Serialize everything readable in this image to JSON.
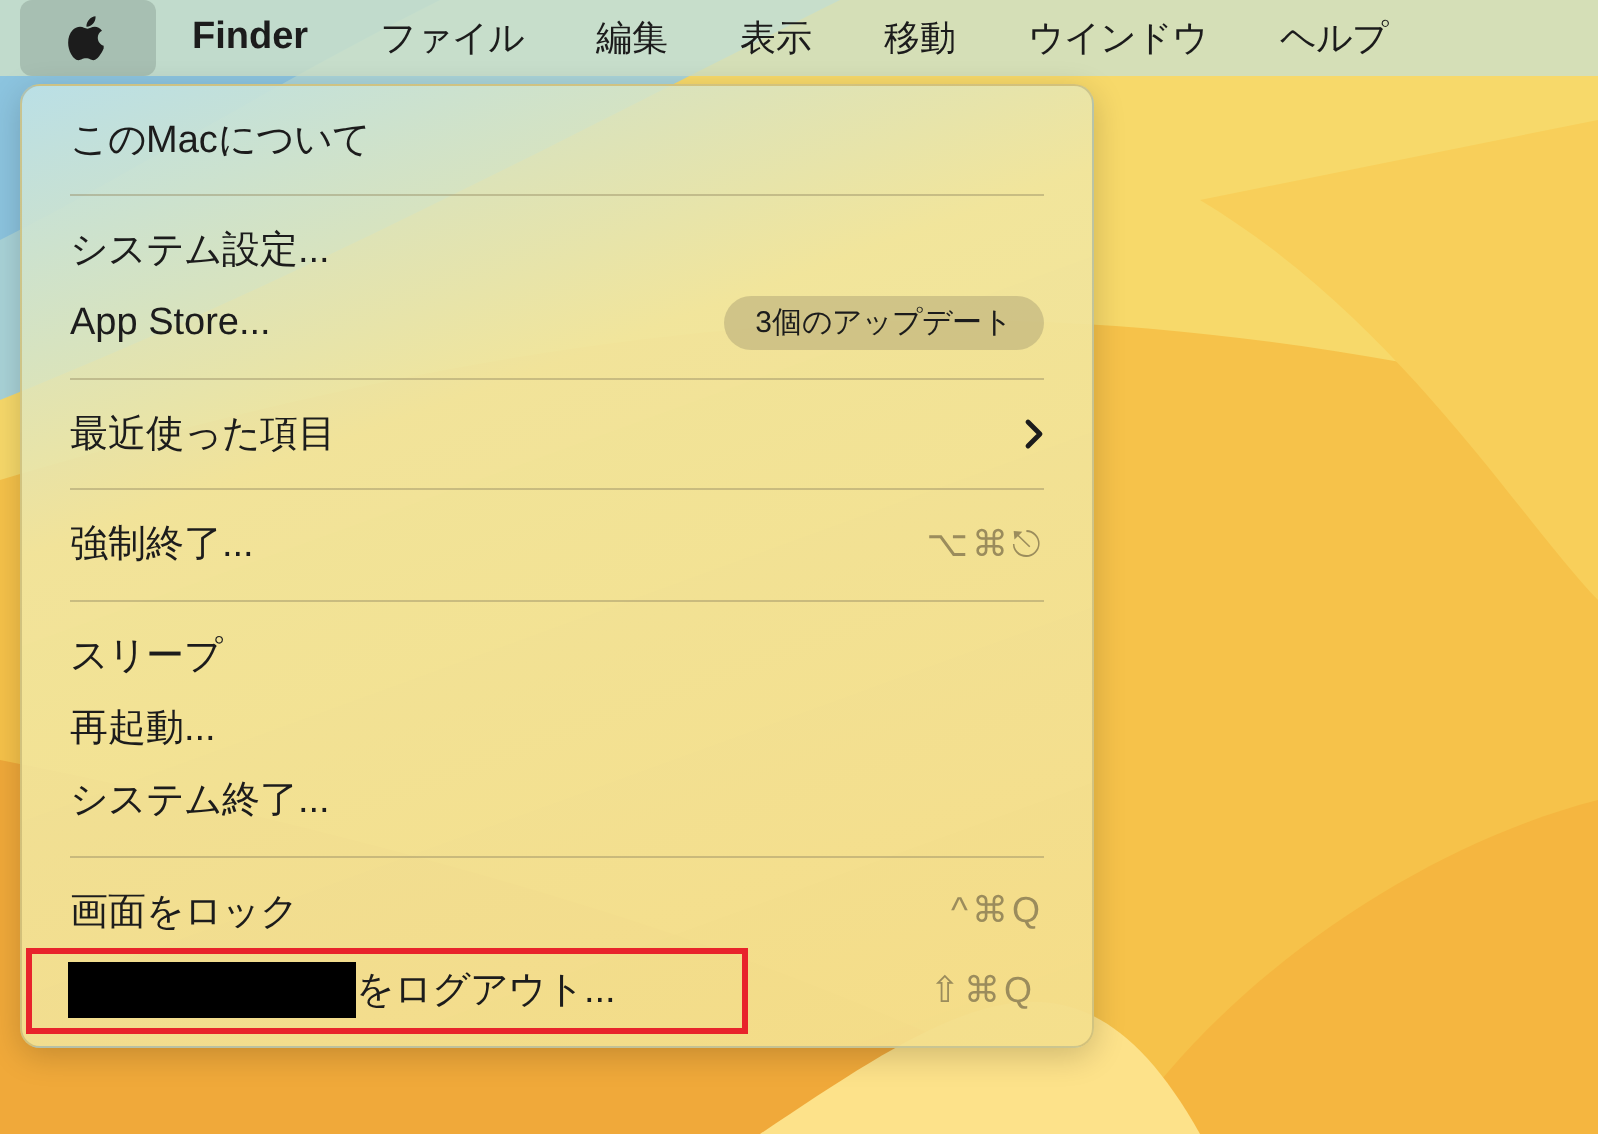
{
  "menubar": {
    "items": [
      {
        "kind": "apple",
        "selected": true
      },
      {
        "kind": "app",
        "label": "Finder",
        "selected": false
      },
      {
        "kind": "menu",
        "label": "ファイル",
        "selected": false
      },
      {
        "kind": "menu",
        "label": "編集",
        "selected": false
      },
      {
        "kind": "menu",
        "label": "表示",
        "selected": false
      },
      {
        "kind": "menu",
        "label": "移動",
        "selected": false
      },
      {
        "kind": "menu",
        "label": "ウインドウ",
        "selected": false
      },
      {
        "kind": "menu",
        "label": "ヘルプ",
        "selected": false
      }
    ]
  },
  "menu": {
    "sections": [
      [
        {
          "kind": "plain",
          "label": "このMacについて",
          "framed": false
        }
      ],
      [
        {
          "kind": "plain",
          "label": "システム設定...",
          "framed": false
        },
        {
          "kind": "plain",
          "label": "App Store...",
          "badge": "3個のアップデート",
          "framed": false
        }
      ],
      [
        {
          "kind": "submenu",
          "label": "最近使った項目",
          "framed": false
        }
      ],
      [
        {
          "kind": "plain",
          "label": "強制終了...",
          "shortcut": "⌥⌘⎋",
          "framed": false
        }
      ],
      [
        {
          "kind": "plain",
          "label": "スリープ",
          "framed": false
        },
        {
          "kind": "plain",
          "label": "再起動...",
          "framed": false
        },
        {
          "kind": "plain",
          "label": "システム終了...",
          "framed": false
        }
      ],
      [
        {
          "kind": "plain",
          "label": "画面をロック",
          "shortcut": "^⌘Q",
          "framed": false
        },
        {
          "kind": "account",
          "label": "をログアウト...",
          "shortcut": "⇧⌘Q",
          "framed": true
        }
      ]
    ]
  }
}
